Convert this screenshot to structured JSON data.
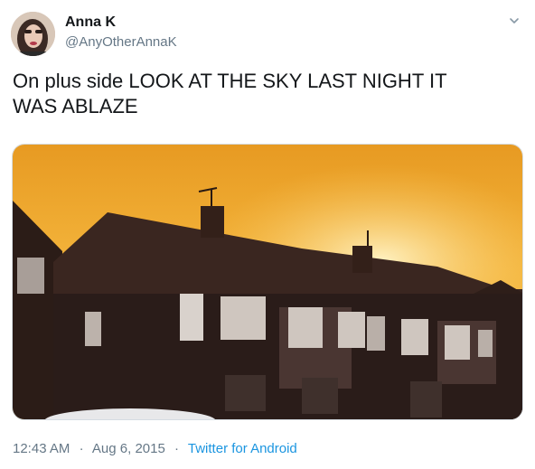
{
  "user": {
    "name": "Anna K",
    "handle": "@AnyOtherAnnaK"
  },
  "tweet": {
    "text_line1": "On plus side LOOK AT THE SKY LAST NIGHT IT",
    "text_line2": "WAS ABLAZE"
  },
  "meta": {
    "time": "12:43 AM",
    "separator": "·",
    "date": "Aug 6, 2015",
    "source": "Twitter for Android"
  },
  "icons": {
    "caret": "chevron-down-icon"
  },
  "colors": {
    "link": "#1b95e0",
    "secondary_text": "#657786",
    "sky": "#f2b43a"
  }
}
